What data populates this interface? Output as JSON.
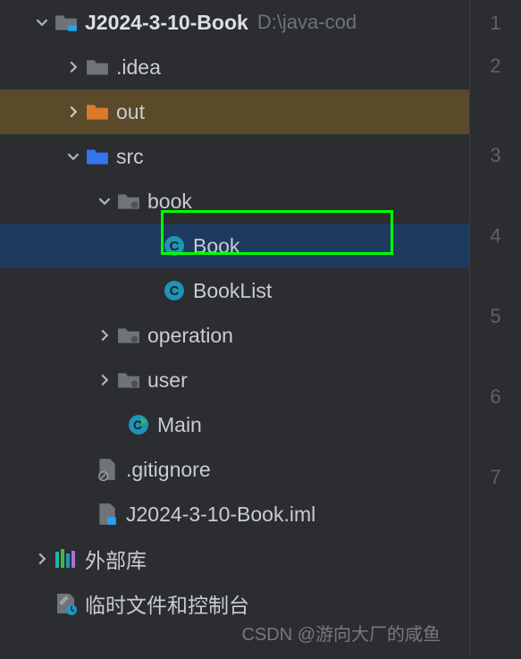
{
  "project": {
    "root": {
      "name": "J2024-3-10-Book",
      "path": "D:\\java-cod"
    },
    "idea": ".idea",
    "out": "out",
    "src": "src",
    "book_pkg": "book",
    "book_cls": "Book",
    "booklist_cls": "BookList",
    "operation_pkg": "operation",
    "user_pkg": "user",
    "main_cls": "Main",
    "gitignore": ".gitignore",
    "iml": "J2024-3-10-Book.iml",
    "ext_lib": "外部库",
    "scratch": "临时文件和控制台"
  },
  "gutter": [
    "1",
    "2",
    "3",
    "4",
    "5",
    "6",
    "7"
  ],
  "watermark": "CSDN @游向大厂的咸鱼"
}
